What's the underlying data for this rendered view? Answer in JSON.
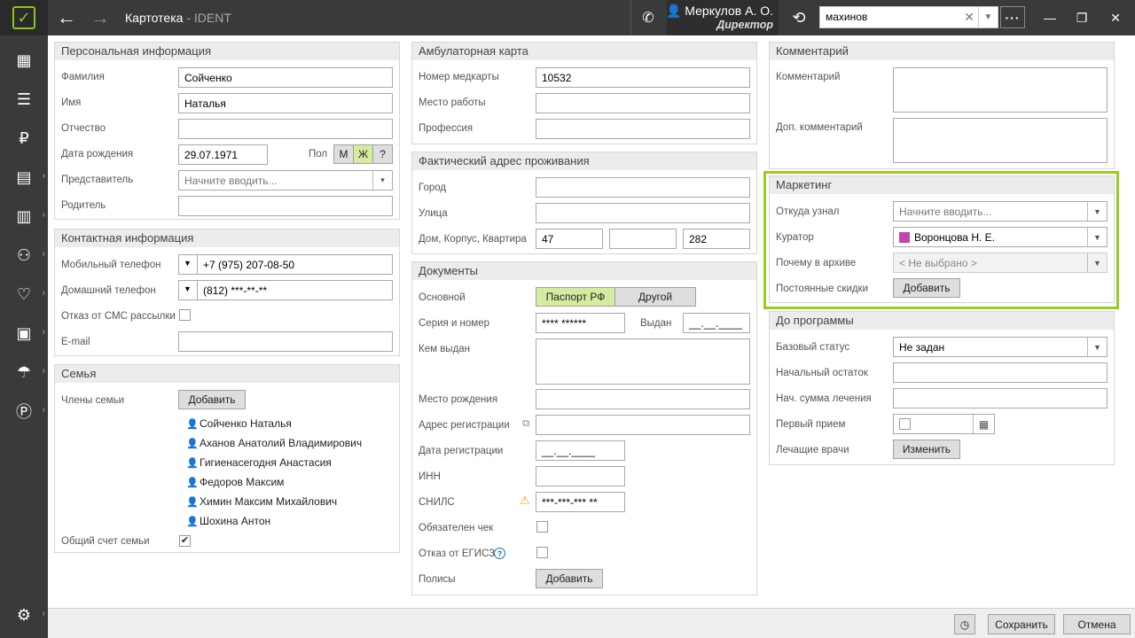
{
  "header": {
    "title": "Картотека",
    "subtitle": "- IDENT",
    "user_name": "Меркулов А. О.",
    "user_role": "Директор",
    "search_value": "махинов"
  },
  "sidebar": {
    "icons": [
      "schedule-icon",
      "tasks-icon",
      "payments-icon",
      "documents-icon",
      "reports-icon",
      "patients-icon",
      "dental-icon",
      "clinic-icon",
      "insurance-icon",
      "finance-icon",
      "settings-icon"
    ]
  },
  "personal": {
    "title": "Персональная информация",
    "surname_label": "Фамилия",
    "surname": "Сойченко",
    "name_label": "Имя",
    "name": "Наталья",
    "patronymic_label": "Отчество",
    "patronymic": "",
    "birth_label": "Дата рождения",
    "birth": "29.07.1971",
    "gender_label": "Пол",
    "gender_m": "М",
    "gender_f": "Ж",
    "gender_q": "?",
    "rep_label": "Представитель",
    "rep_placeholder": "Начните вводить...",
    "parent_label": "Родитель",
    "parent": ""
  },
  "contact": {
    "title": "Контактная информация",
    "mobile_label": "Мобильный телефон",
    "mobile": "+7 (975) 207-08-50",
    "home_label": "Домашний телефон",
    "home": "(812) ***-**-**",
    "sms_label": "Отказ от СМС рассылки",
    "email_label": "E-mail",
    "email": ""
  },
  "family": {
    "title": "Семья",
    "members_label": "Члены семьи",
    "add_button": "Добавить",
    "members": [
      {
        "name": "Сойченко Наталья",
        "color": "#f0a500"
      },
      {
        "name": "Аханов Анатолий Владимирович",
        "color": "#f0a500"
      },
      {
        "name": "Гигиенасегодня Анастасия",
        "color": "#e05050"
      },
      {
        "name": "Федоров Максим",
        "color": "#e05050"
      },
      {
        "name": "Химин Максим Михайлович",
        "color": "#999999"
      },
      {
        "name": "Шохина Антон",
        "color": "#f0a500"
      }
    ],
    "shared_label": "Общий счет семьи",
    "shared_check": "✔"
  },
  "ambulatory": {
    "title": "Амбулаторная карта",
    "card_label": "Номер медкарты",
    "card": "10532",
    "work_label": "Место работы",
    "work": "",
    "prof_label": "Профессия",
    "prof": ""
  },
  "address": {
    "title": "Фактический адрес проживания",
    "city_label": "Город",
    "city": "",
    "street_label": "Улица",
    "street": "",
    "house_label": "Дом, Корпус, Квартира",
    "house": "47",
    "corpus": "",
    "flat": "282"
  },
  "documents": {
    "title": "Документы",
    "main_label": "Основной",
    "passport": "Паспорт РФ",
    "other": "Другой",
    "series_label": "Серия и номер",
    "series": "**** ******",
    "issued_label": "Выдан",
    "issued": "__.__.____",
    "issuer_label": "Кем выдан",
    "birthplace_label": "Место рождения",
    "reg_addr_label": "Адрес регистрации",
    "reg_date_label": "Дата регистрации",
    "reg_date": "__.__.____",
    "inn_label": "ИНН",
    "snils_label": "СНИЛС",
    "snils": "***-***-*** **",
    "receipt_label": "Обязателен чек",
    "egisz_label": "Отказ от ЕГИСЗ",
    "policies_label": "Полисы",
    "add_button": "Добавить"
  },
  "comment": {
    "title": "Комментарий",
    "comment_label": "Комментарий",
    "extra_label": "Доп. комментарий"
  },
  "marketing": {
    "title": "Маркетинг",
    "source_label": "Откуда узнал",
    "source_placeholder": "Начните вводить...",
    "curator_label": "Куратор",
    "curator": "Воронцова Н. Е.",
    "curator_color": "#c342b3",
    "archive_label": "Почему в архиве",
    "archive": "< Не выбрано >",
    "discount_label": "Постоянные скидки",
    "add_button": "Добавить"
  },
  "preprogram": {
    "title": "До программы",
    "status_label": "Базовый статус",
    "status": "Не задан",
    "balance_label": "Начальный остаток",
    "sum_label": "Нач. сумма лечения",
    "first_label": "Первый прием",
    "doctors_label": "Лечащие врачи",
    "change_button": "Изменить"
  },
  "footer": {
    "save": "Сохранить",
    "cancel": "Отмена"
  },
  "colors": {
    "accent": "#9acb1e",
    "topbar": "#3a3a3a"
  }
}
